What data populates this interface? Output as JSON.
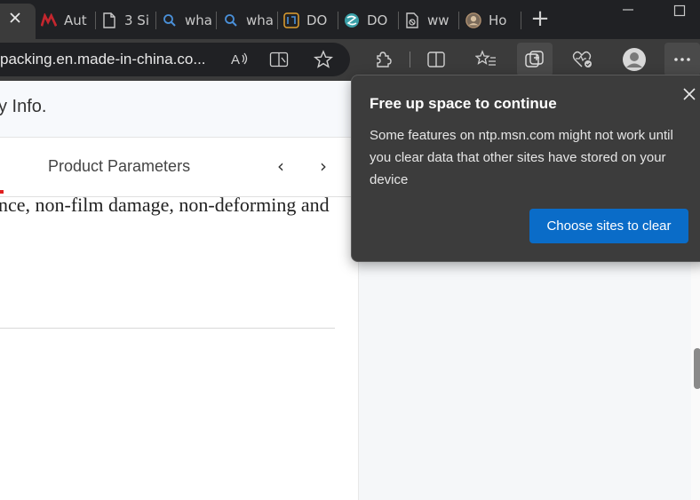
{
  "tabs": [
    {
      "label": "Aut",
      "icon": "made-in-china-logo-icon",
      "color": "#c4262e"
    },
    {
      "label": "3 Si",
      "icon": "page-icon"
    },
    {
      "label": "wha",
      "icon": "search-icon"
    },
    {
      "label": "wha",
      "icon": "search-icon"
    },
    {
      "label": "DO",
      "icon": "translate-icon"
    },
    {
      "label": "DO",
      "icon": "globe-icon"
    },
    {
      "label": "ww",
      "icon": "broken-page-icon"
    },
    {
      "label": "Ho",
      "icon": "avatar-icon"
    }
  ],
  "new_tab_symbol": "+",
  "address_bar": {
    "url": "packing.en.made-in-china.co..."
  },
  "page": {
    "info_text": "y Info.",
    "product_parameters_label": "Product Parameters",
    "prev_arrow": "‹",
    "next_arrow": "›",
    "description": "nce, non-film damage, non-deforming and"
  },
  "popup": {
    "title": "Free up space to continue",
    "body": "Some features on ntp.msn.com might not work until you clear data that other sites have stored on your device",
    "button_label": "Choose sites to clear",
    "button_color": "#0a6cc8"
  }
}
